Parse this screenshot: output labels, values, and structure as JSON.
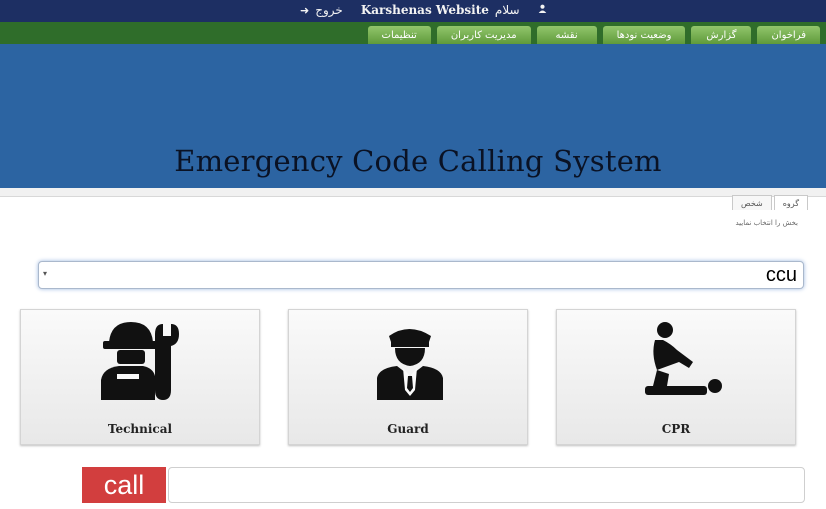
{
  "topbar": {
    "logout_icon": "logout-icon",
    "logout_label": "خروج",
    "site_title": "Karshenas Website",
    "greeting": "سلام",
    "user_icon": "user-icon"
  },
  "nav": {
    "items": [
      {
        "label": "فراخوان"
      },
      {
        "label": "گزارش"
      },
      {
        "label": "وضعیت نودها"
      },
      {
        "label": "نقشه"
      },
      {
        "label": "مدیریت کاربران"
      },
      {
        "label": "تنظیمات"
      }
    ]
  },
  "banner": {
    "title": "Emergency Code Calling System"
  },
  "panel": {
    "tabs": [
      {
        "label": "گروه"
      },
      {
        "label": "شخص"
      }
    ],
    "select_label": "بخش را انتخاب نمایید",
    "search": {
      "caret": "▾",
      "value": "ccu"
    }
  },
  "cards": [
    {
      "label": "Technical",
      "icon": "technician-icon"
    },
    {
      "label": "Guard",
      "icon": "guard-icon"
    },
    {
      "label": "CPR",
      "icon": "cpr-icon"
    }
  ],
  "call": {
    "label": "call",
    "input_value": ""
  },
  "colors": {
    "topbar": "#1d2f63",
    "navbar": "#2f6d2a",
    "nav_tab": "#7bb155",
    "banner": "#2c64a2",
    "call_button": "#d23e3e"
  }
}
